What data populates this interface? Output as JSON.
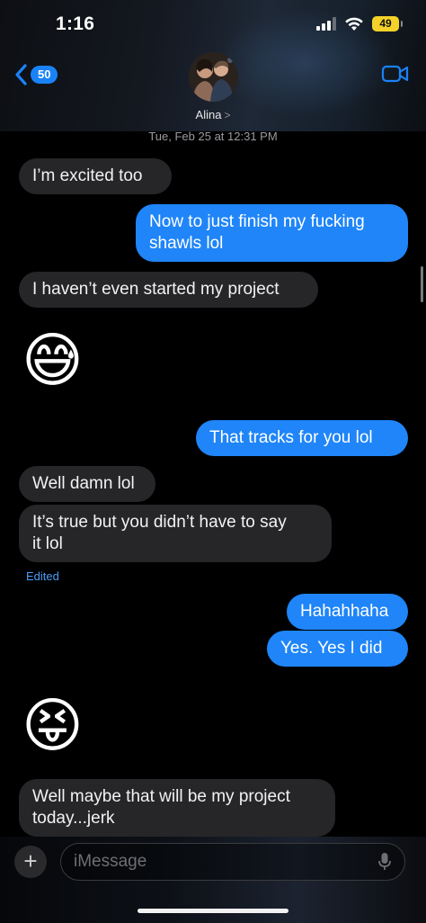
{
  "status_bar": {
    "time": "1:16",
    "battery": "49"
  },
  "nav": {
    "back_count": "50",
    "contact_name": "Alina",
    "name_chevron": ">"
  },
  "conversation": {
    "timestamp_day": "Tue, Feb 25",
    "timestamp_at": "at",
    "timestamp_time": "12:31 PM",
    "messages": [
      {
        "direction": "incoming",
        "text": "I’m excited too"
      },
      {
        "direction": "outgoing",
        "line1": "Now to just finish my fucking",
        "line2": "shawls lol"
      },
      {
        "direction": "incoming",
        "text": "I haven’t even started my project"
      },
      {
        "direction": "incoming",
        "emoji": "😅"
      },
      {
        "direction": "outgoing",
        "text": "That tracks for you lol"
      },
      {
        "direction": "incoming",
        "text": "Well damn lol"
      },
      {
        "direction": "incoming",
        "line1": "It’s true but you didn’t have to say",
        "line2": "it lol",
        "edited_label": "Edited"
      },
      {
        "direction": "outgoing",
        "text": "Hahahhaha"
      },
      {
        "direction": "outgoing",
        "text": "Yes. Yes I did"
      },
      {
        "direction": "incoming",
        "emoji": "😝"
      },
      {
        "direction": "incoming",
        "line1": "Well maybe that will be my project",
        "line2": "today...jerk"
      }
    ]
  },
  "composer": {
    "plus_label": "+",
    "placeholder": "iMessage"
  },
  "colors": {
    "outgoing_bubble": "#1f85f8",
    "incoming_bubble": "#262629",
    "accent": "#1a82f7",
    "battery": "#f5d22a"
  },
  "icons": {
    "back": "chevron-left-icon",
    "facetime": "video-camera-icon",
    "wifi": "wifi-icon",
    "signal": "cellular-signal-icon",
    "mic": "microphone-icon"
  }
}
